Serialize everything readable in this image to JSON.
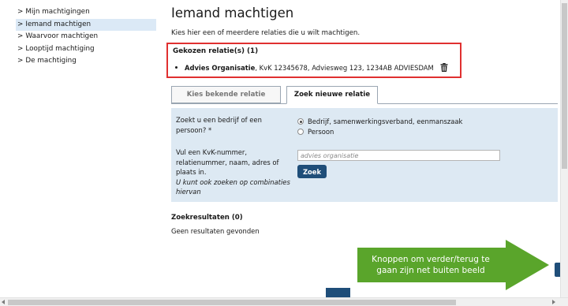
{
  "sidebar": {
    "items": [
      {
        "label": "Mijn machtigingen",
        "active": false
      },
      {
        "label": "Iemand machtigen",
        "active": true
      },
      {
        "label": "Waarvoor machtigen",
        "active": false
      },
      {
        "label": "Looptijd machtiging",
        "active": false
      },
      {
        "label": "De machtiging",
        "active": false
      }
    ],
    "chevron": ">"
  },
  "main": {
    "title": "Iemand machtigen",
    "intro": "Kies hier een of meerdere relaties die u wilt machtigen.",
    "chosen": {
      "title": "Gekozen relatie(s) (1)",
      "item_name": "Advies Organisatie",
      "item_details": ", KvK 12345678, Adviesweg 123, 1234AB ADVIESDAM",
      "delete_icon": "trash-icon"
    },
    "tabs": [
      {
        "label": "Kies bekende relatie",
        "selected": false
      },
      {
        "label": "Zoek nieuwe relatie",
        "selected": true
      }
    ],
    "form": {
      "question1": "Zoekt u een bedrijf of een persoon? *",
      "options": [
        {
          "label": "Bedrijf, samenwerkingsverband, eenmanszaak",
          "checked": true
        },
        {
          "label": "Persoon",
          "checked": false
        }
      ],
      "question2": "Vul een KvK-nummer, relatienummer, naam, adres of plaats in.",
      "hint": "U kunt ook zoeken op combinaties hiervan",
      "search_value": "advies organisatie",
      "search_button": "Zoek"
    },
    "results": {
      "title": "Zoekresultaten (0)",
      "empty_text": "Geen resultaten gevonden"
    }
  },
  "annotation": {
    "text": "Knoppen om verder/terug te gaan zijn net buiten beeld",
    "color": "#5aa52b"
  },
  "colors": {
    "accent": "#1f4e79",
    "panel": "#dde9f3",
    "highlight_border": "#e03030",
    "nav_active": "#dbe9f6"
  }
}
